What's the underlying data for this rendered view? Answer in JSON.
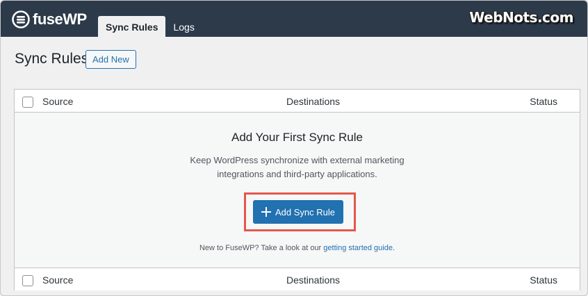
{
  "app": {
    "logo_text": "fuseWP",
    "watermark": "WebNots.com"
  },
  "nav": {
    "tabs": [
      {
        "label": "Sync Rules",
        "active": true
      },
      {
        "label": "Logs",
        "active": false
      }
    ]
  },
  "header": {
    "title": "Sync Rules",
    "add_new_label": "Add New"
  },
  "table": {
    "columns": {
      "source": "Source",
      "destinations": "Destinations",
      "status": "Status"
    }
  },
  "empty_state": {
    "title": "Add Your First Sync Rule",
    "description": "Keep WordPress synchronize with external marketing integrations and third-party applications.",
    "button_label": "Add Sync Rule",
    "hint_prefix": "New to FuseWP? Take a look at our ",
    "hint_link": "getting started guide",
    "hint_suffix": "."
  },
  "colors": {
    "topbar": "#2c3a4a",
    "accent": "#2271b1",
    "highlight": "#e5574b",
    "background": "#f0f0f1"
  },
  "icons": [
    "fusewp-logo-icon",
    "plus-icon",
    "checkbox-icon"
  ]
}
